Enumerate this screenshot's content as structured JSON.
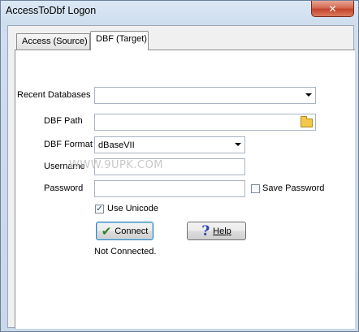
{
  "window": {
    "title": "AccessToDbf Logon",
    "close_glyph": "✕"
  },
  "tabs": [
    {
      "label": "Access (Source)",
      "active": false
    },
    {
      "label": "DBF (Target)",
      "active": true
    }
  ],
  "form": {
    "recent_databases": {
      "label": "Recent Databases",
      "value": ""
    },
    "dbf_path": {
      "label": "DBF Path",
      "value": "",
      "icon": "folder-icon"
    },
    "dbf_format": {
      "label": "DBF Format",
      "value": "dBaseVII"
    },
    "username": {
      "label": "Username",
      "value": ""
    },
    "password": {
      "label": "Password",
      "value": ""
    },
    "save_password": {
      "label": "Save Password",
      "checked": false
    },
    "use_unicode": {
      "label": "Use Unicode",
      "checked": true,
      "mark": "✓"
    }
  },
  "buttons": {
    "connect": {
      "label": "Connect",
      "icon_glyph": "✔",
      "icon": "checkmark-icon"
    },
    "help": {
      "label": "Help",
      "icon_glyph": "?",
      "icon": "question-icon"
    }
  },
  "status": {
    "text": "Not Connected."
  },
  "watermark": {
    "text": "WWW.9UPK.COM"
  },
  "colors": {
    "close_button": "#c4452c",
    "panel_bg": "#ffffff",
    "dialog_bg": "#f0f0f0"
  }
}
